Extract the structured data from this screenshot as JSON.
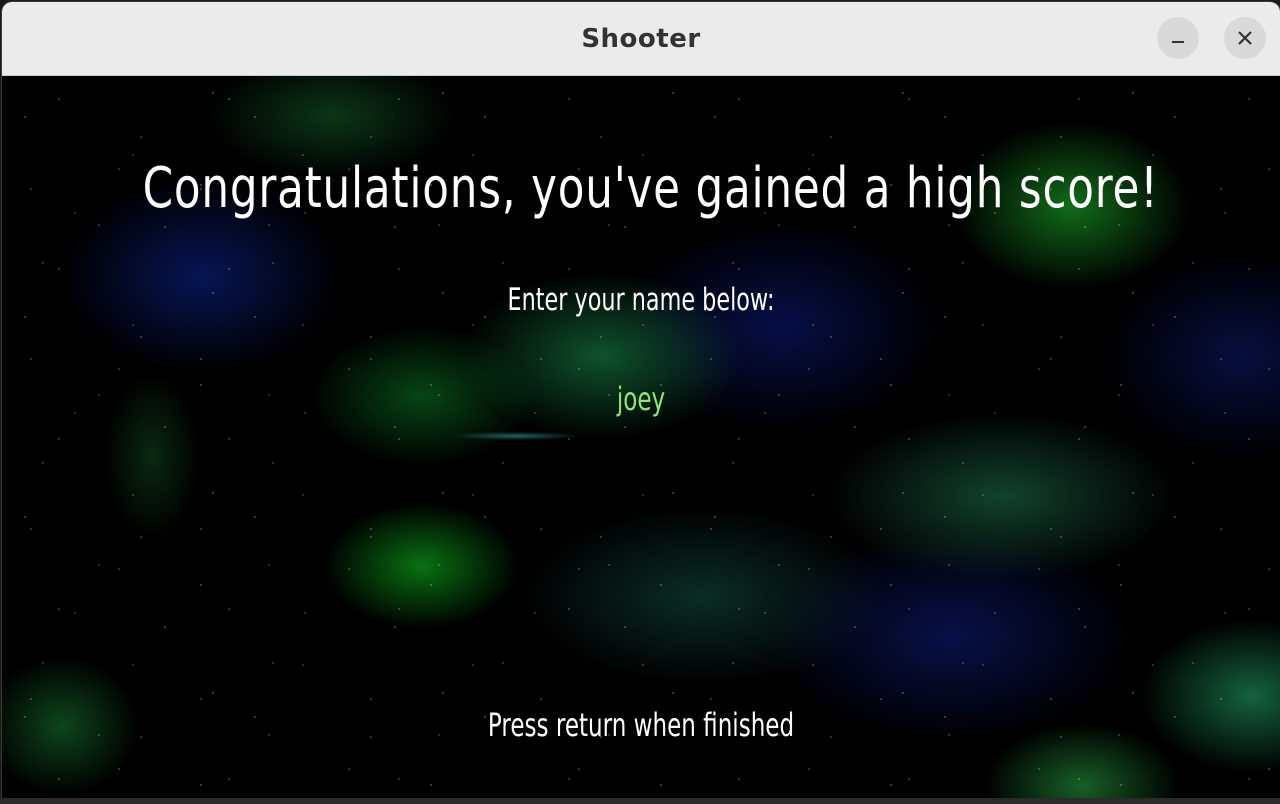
{
  "window": {
    "title": "Shooter"
  },
  "controls": {
    "minimize_icon": "minimize-icon",
    "close_icon": "close-icon"
  },
  "game": {
    "heading": "Congratulations, you've gained a high score!",
    "prompt": "Enter your name below:",
    "name_value": "joey",
    "hint": "Press return when finished"
  },
  "colors": {
    "titlebar_bg": "#ebebeb",
    "name_text": "#8ee57a",
    "text": "#ffffff"
  }
}
